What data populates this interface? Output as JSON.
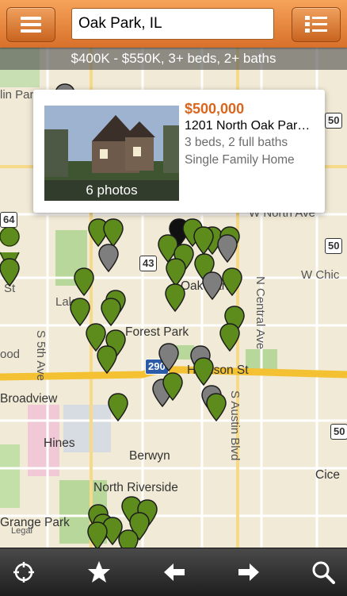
{
  "header": {
    "search_value": "Oak Park, IL",
    "menu_icon": "hamburger-icon",
    "list_icon": "list-view-icon"
  },
  "filter_text": "$400K - $550K, 3+ beds, 2+ baths",
  "listing": {
    "price": "$500,000",
    "address": "1201 North Oak Par…",
    "beds_baths": "3 beds, 2 full baths",
    "type": "Single Family Home",
    "photos": "6 photos"
  },
  "map_labels": {
    "oak_park": "Oak Park",
    "forest_park": "Forest Park",
    "harrison": "Harrison St",
    "broadview": "Broadview",
    "hines": "Hines",
    "berwyn": "Berwyn",
    "north_riverside": "North Riverside",
    "grange_park": "Grange Park",
    "cicero": "Cice",
    "w_north_ave": "W North Ave",
    "w_chic": "W Chic",
    "n_central": "N Central Ave",
    "s_austin": "S Austin Blvd",
    "s_5th": "S 5th Ave",
    "lin_park": "lin Par",
    "ood": "ood",
    "st": "St",
    "lake": "Lake",
    "legal": "Legal"
  },
  "road_shields": {
    "r64": "64",
    "r43": "43",
    "r50a": "50",
    "r50b": "50",
    "r50c": "50",
    "r290": "290"
  },
  "colors": {
    "accent_orange": "#d9661d",
    "pin_green": "#5d8c1c",
    "pin_gray": "#7e7e7e",
    "pin_black": "#111111"
  },
  "toolbar": {
    "locate_icon": "crosshair-icon",
    "favorite_icon": "star-icon",
    "back_icon": "arrow-left-icon",
    "forward_icon": "arrow-right-icon",
    "search_icon": "magnifier-icon"
  }
}
